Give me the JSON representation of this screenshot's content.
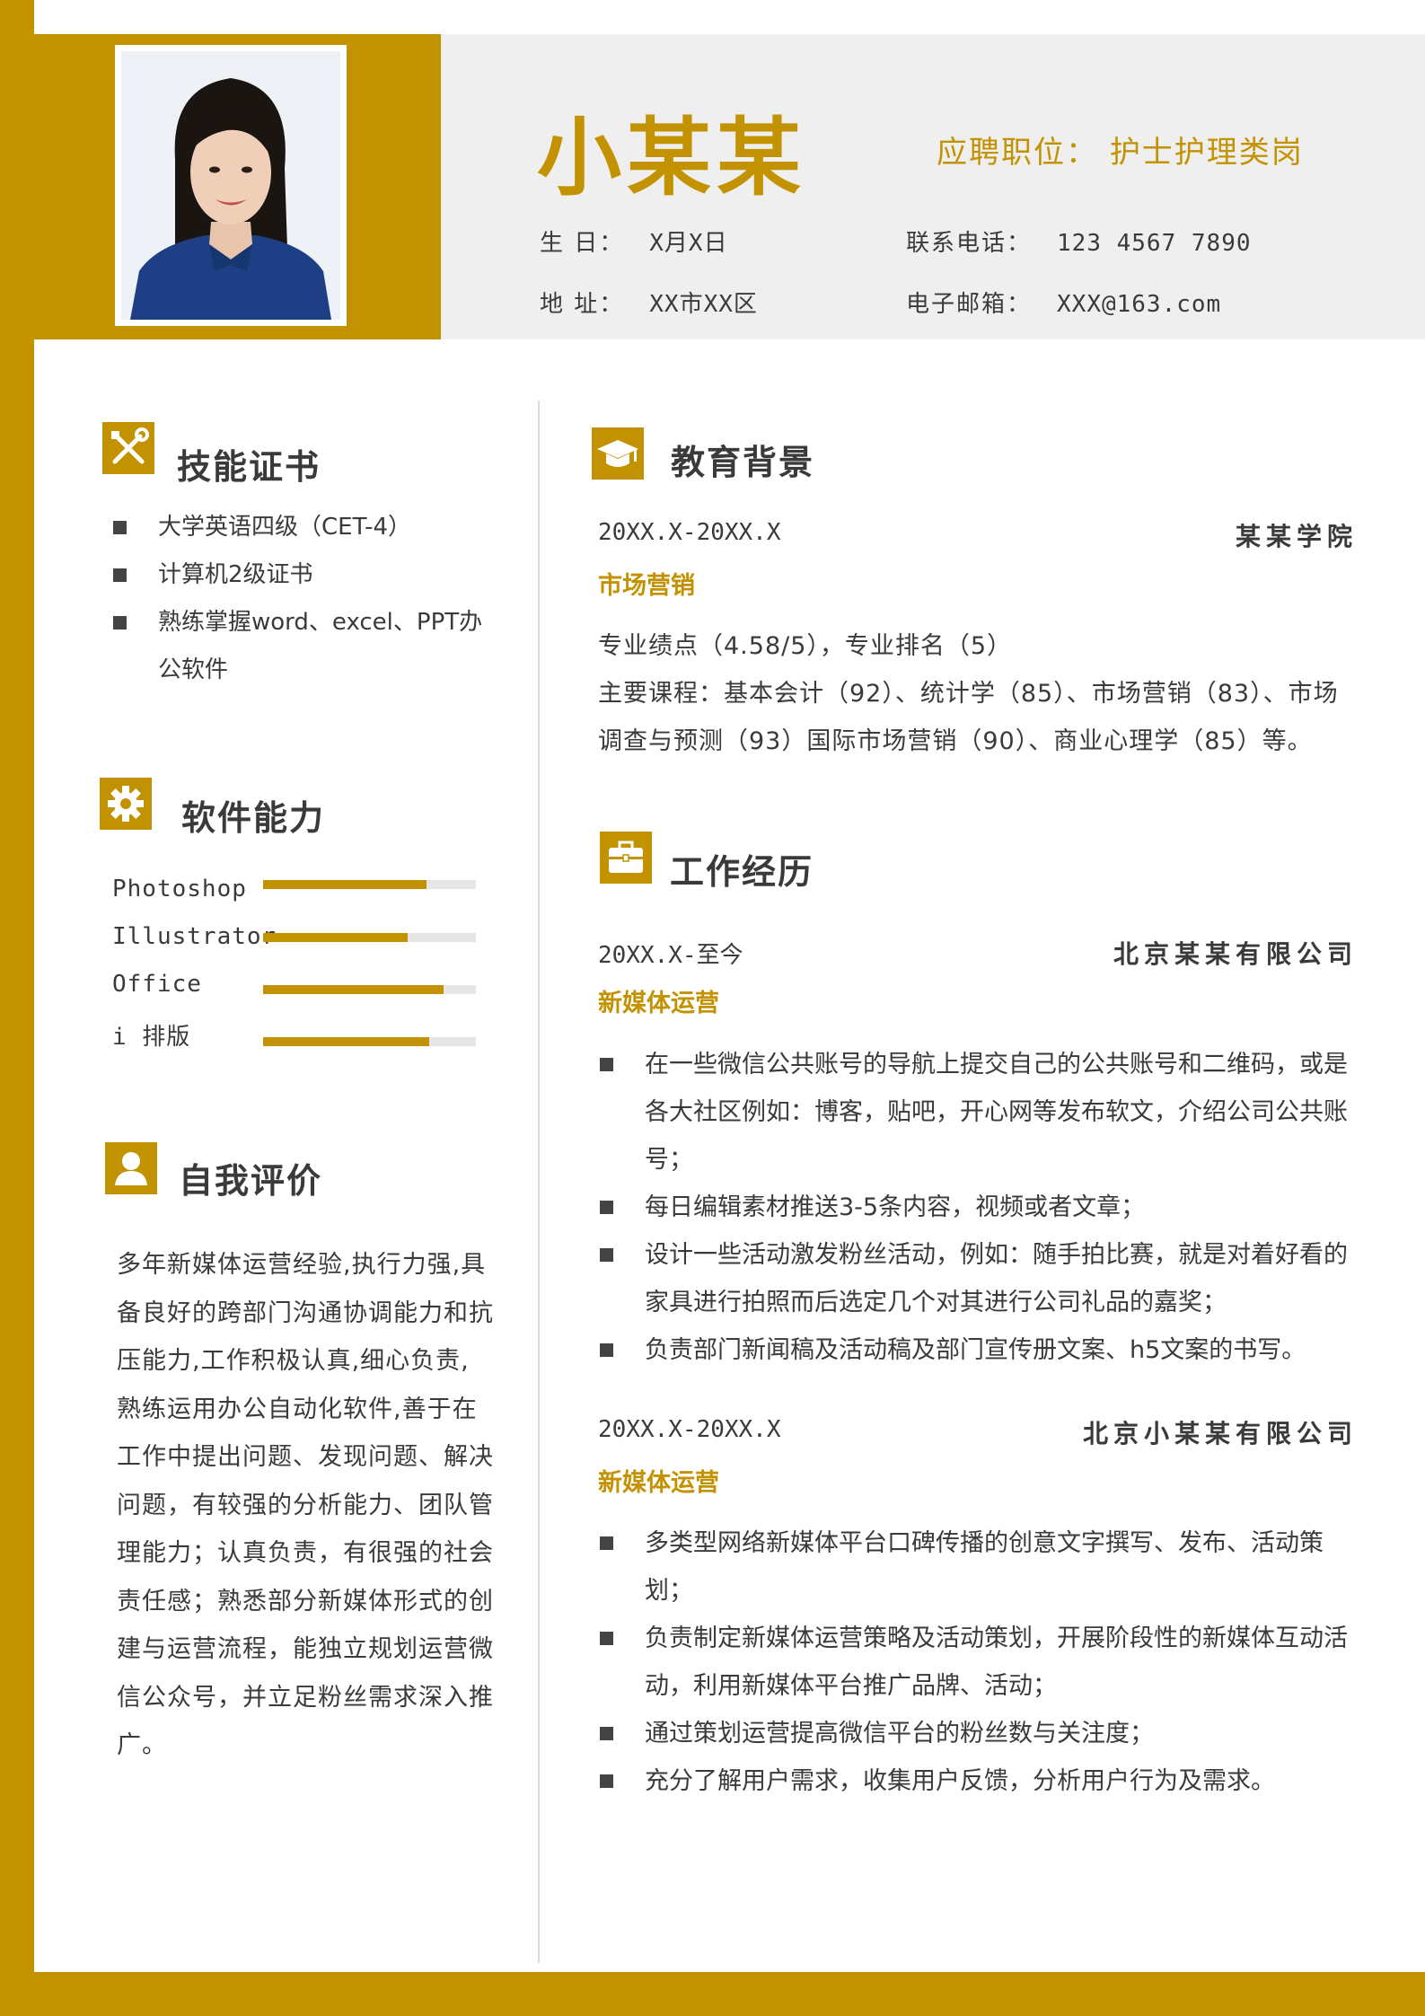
{
  "header": {
    "name": "小某某",
    "job_label": "应聘职位：",
    "job_value": "护士护理类岗",
    "birth_label": "生  日：",
    "birth_value": "X月X日",
    "phone_label": "联系电话：",
    "phone_value": "123 4567 7890",
    "address_label": "地  址：",
    "address_value": "XX市XX区",
    "email_label": "电子邮箱：",
    "email_value": "XXX@163.com"
  },
  "skills": {
    "title": "技能证书",
    "icon": "tools-icon",
    "items": [
      "大学英语四级（CET-4）",
      "计算机2级证书",
      "熟练掌握word、excel、PPT办公软件"
    ]
  },
  "software": {
    "title": "软件能力",
    "icon": "gear-icon",
    "items": [
      {
        "label": "Photoshop",
        "level": 0.77
      },
      {
        "label": "Illustrator",
        "level": 0.68
      },
      {
        "label": "Office",
        "level": 0.85
      },
      {
        "label": "i 排版",
        "level": 0.78
      }
    ]
  },
  "self": {
    "title": "自我评价",
    "icon": "person-icon",
    "text": "多年新媒体运营经验,执行力强,具备良好的跨部门沟通协调能力和抗压能力,工作积极认真,细心负责,熟练运用办公自动化软件,善于在工作中提出问题、发现问题、解决问题，有较强的分析能力、团队管理能力；认真负责，有很强的社会责任感；熟悉部分新媒体形式的创建与运营流程，能独立规划运营微信公众号，并立足粉丝需求深入推广。"
  },
  "education": {
    "title": "教育背景",
    "icon": "graduation-cap-icon",
    "period": "20XX.X-20XX.X",
    "school": "某某学院",
    "major": "市场营销",
    "gpa": "专业绩点（4.58/5），专业排名（5）",
    "courses": "主要课程：基本会计（92）、统计学（85）、市场营销（83）、市场调查与预测（93）国际市场营销（90）、商业心理学（85）等。"
  },
  "work": {
    "title": "工作经历",
    "icon": "briefcase-icon",
    "jobs": [
      {
        "period": "20XX.X-至今",
        "company": "北京某某有限公司",
        "role": "新媒体运营",
        "items": [
          "在一些微信公共账号的导航上提交自己的公共账号和二维码，或是各大社区例如：博客，贴吧，开心网等发布软文，介绍公司公共账号；",
          "每日编辑素材推送3-5条内容，视频或者文章；",
          "设计一些活动激发粉丝活动，例如：随手拍比赛，就是对着好看的家具进行拍照而后选定几个对其进行公司礼品的嘉奖；",
          "负责部门新闻稿及活动稿及部门宣传册文案、h5文案的书写。"
        ]
      },
      {
        "period": "20XX.X-20XX.X",
        "company": "北京小某某有限公司",
        "role": "新媒体运营",
        "items": [
          "多类型网络新媒体平台口碑传播的创意文字撰写、发布、活动策划；",
          "负责制定新媒体运营策略及活动策划，开展阶段性的新媒体互动活动，利用新媒体平台推广品牌、活动；",
          "通过策划运营提高微信平台的粉丝数与关注度；",
          "充分了解用户需求，收集用户反馈，分析用户行为及需求。"
        ]
      }
    ]
  }
}
